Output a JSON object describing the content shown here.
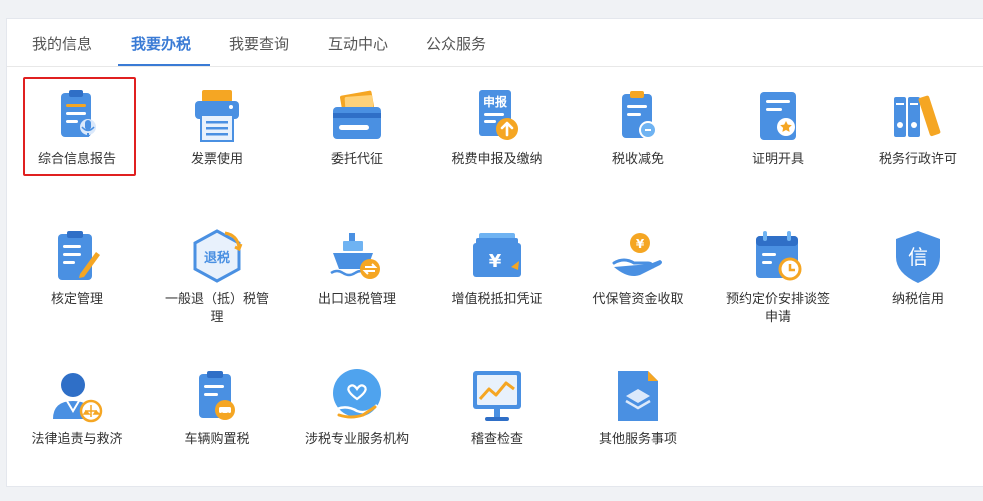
{
  "tabs": [
    {
      "label": "我的信息"
    },
    {
      "label": "我要办税",
      "active": true
    },
    {
      "label": "我要查询"
    },
    {
      "label": "互动中心"
    },
    {
      "label": "公众服务"
    }
  ],
  "items": [
    {
      "label": "综合信息报告",
      "icon": "comprehensive-report-icon",
      "selected": true
    },
    {
      "label": "发票使用",
      "icon": "invoice-printer-icon"
    },
    {
      "label": "委托代征",
      "icon": "entrusted-collection-icon"
    },
    {
      "label": "税费申报及缴纳",
      "icon": "tax-declaration-icon"
    },
    {
      "label": "税收减免",
      "icon": "tax-reduction-icon"
    },
    {
      "label": "证明开具",
      "icon": "certificate-icon"
    },
    {
      "label": "税务行政许可",
      "icon": "administrative-license-icon"
    },
    {
      "label": "核定管理",
      "icon": "assessment-management-icon"
    },
    {
      "label": "一般退（抵）税管理",
      "icon": "tax-refund-icon"
    },
    {
      "label": "出口退税管理",
      "icon": "export-refund-icon"
    },
    {
      "label": "增值税抵扣凭证",
      "icon": "vat-deduction-icon"
    },
    {
      "label": "代保管资金收取",
      "icon": "fund-custody-icon"
    },
    {
      "label": "预约定价安排谈签申请",
      "icon": "pricing-arrangement-icon"
    },
    {
      "label": "纳税信用",
      "icon": "tax-credit-icon"
    },
    {
      "label": "法律追责与救济",
      "icon": "legal-remedy-icon"
    },
    {
      "label": "车辆购置税",
      "icon": "vehicle-purchase-tax-icon"
    },
    {
      "label": "涉税专业服务机构",
      "icon": "tax-service-agency-icon"
    },
    {
      "label": "稽查检查",
      "icon": "inspection-icon"
    },
    {
      "label": "其他服务事项",
      "icon": "other-services-icon"
    }
  ],
  "icon_badge_text": {
    "declare": "申报",
    "refund": "退税",
    "credit": "信",
    "yuan": "¥"
  },
  "colors": {
    "accent": "#3a7bd5",
    "icon_blue": "#4a90e2",
    "icon_orange": "#f5a623",
    "highlight_border": "#e02020"
  }
}
